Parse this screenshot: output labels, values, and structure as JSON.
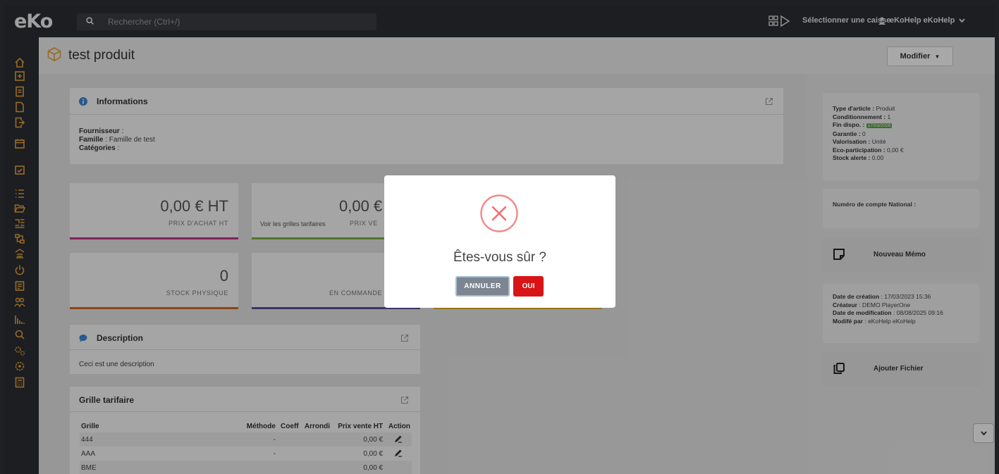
{
  "app": {
    "logo": "eKo",
    "search_placeholder": "Rechercher (Ctrl+/)"
  },
  "topbar": {
    "caisse_label": "Sélectionner une caisse",
    "user_name": "eKoHelp eKoHelp"
  },
  "page": {
    "title": "test produit",
    "modify_label": "Modifier"
  },
  "informations": {
    "title": "Informations",
    "fournisseur_label": "Fournisseur",
    "fournisseur_value": " :",
    "famille_label": "Famille",
    "famille_value": " : Famille de test",
    "categories_label": "Catégories",
    "categories_value": " :"
  },
  "stats": {
    "prix_achat_value": "0,00 € HT",
    "prix_achat_label": "PRIX D'ACHAT HT",
    "prix_vente_value": "0,00 €",
    "prix_vente_label": "PRIX VE",
    "voir_grilles": "Voir les grilles tarifaires",
    "stock_value": "0",
    "stock_label": "STOCK PHYSIQUE",
    "commande_label": "EN COMMANDE"
  },
  "description": {
    "title": "Description",
    "text": "Ceci est une description"
  },
  "grille": {
    "title": "Grille tarifaire",
    "columns": [
      "Grille",
      "Méthode",
      "Coeff",
      "Arrondi",
      "Prix vente HT",
      "Action"
    ],
    "rows": [
      {
        "grille": "444",
        "methode": "-",
        "prix": "0,00 €"
      },
      {
        "grille": "AAA",
        "methode": "-",
        "prix": "0,00 €"
      },
      {
        "grille": "BME",
        "methode": "",
        "prix": "0,00 €"
      }
    ]
  },
  "details": {
    "type_label": "Type d'article :",
    "type_value": " Produit",
    "cond_label": "Conditionnement :",
    "cond_value": " 1",
    "fin_label": "Fin dispo. :",
    "fin_value": "17/03/2028",
    "garantie_label": "Garantie :",
    "garantie_value": " 0",
    "valo_label": "Valorisation :",
    "valo_value": " Unité",
    "eco_label": "Eco-participation :",
    "eco_value": " 0,00 €",
    "stock_label": "Stock alerte :",
    "stock_value": " 0.00"
  },
  "compte": {
    "label": "Numéro de compte National :"
  },
  "memo": {
    "label": "Nouveau Mémo"
  },
  "audit": {
    "creation_label": "Date de création",
    "creation_value": " : 17/03/2023 15:36",
    "createur_label": "Créateur",
    "createur_value": " : DEMO PlayerOne",
    "modif_label": "Date de modification",
    "modif_value": " : 08/08/2025 09:16",
    "modifpar_label": "Modifé par",
    "modifpar_value": " : eKoHelp eKoHelp"
  },
  "fichier": {
    "label": "Ajouter Fichier"
  },
  "modal": {
    "question": "Êtes-vous sûr ?",
    "cancel": "ANNULER",
    "ok": "OUI"
  },
  "colors": {
    "accent": "#e8a33a",
    "danger": "#d81416",
    "pink": "#c2378f",
    "green": "#7bb342",
    "orange": "#d96a1e",
    "purple": "#5b4f97",
    "yellow": "#e3b42c"
  }
}
